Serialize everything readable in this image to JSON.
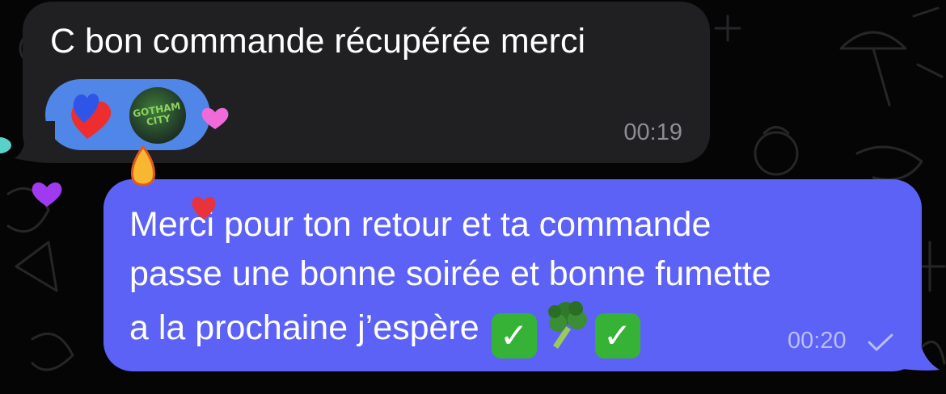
{
  "incoming_message": {
    "text": "C bon commande récupérée merci",
    "time": "00:19",
    "reactions": [
      {
        "icon": "blue-red-hearts-icon"
      },
      {
        "icon": "gotham-city-avatar",
        "avatar_text": "GOTHAM CITY"
      }
    ]
  },
  "outgoing_message": {
    "lines": [
      "Merci pour ton retour et ta commande",
      "passe une bonne soirée et bonne fumette",
      "a la prochaine j’espère"
    ],
    "emojis": [
      "white-check-mark-icon",
      "broccoli-icon",
      "white-check-mark-icon"
    ],
    "time": "00:20",
    "status": "sent-checkmark-icon"
  },
  "colors": {
    "background": "#050506",
    "incoming_bubble": "#202023",
    "outgoing_bubble": "#5c62f6",
    "reaction_pill": "#4f86e7",
    "timestamp_incoming": "#8d8d93",
    "timestamp_outgoing": "#b9bdfb"
  }
}
